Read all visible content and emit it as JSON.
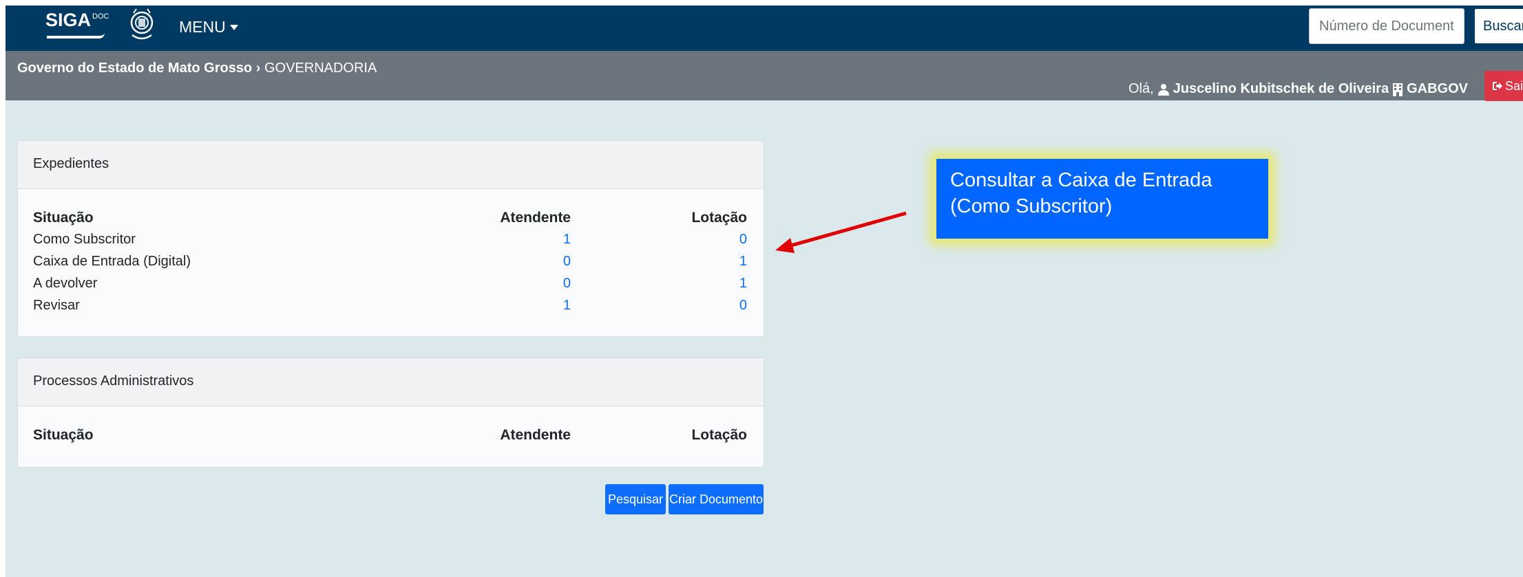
{
  "navbar": {
    "logo_text": "SIGA",
    "logo_sup": "DOC",
    "menu_label": "MENU",
    "doc_search_placeholder": "Número de Documento",
    "search_button": "Buscar"
  },
  "subbar": {
    "breadcrumb_org": "Governo do Estado de Mato Grosso",
    "breadcrumb_sep": "›",
    "breadcrumb_unit": "GOVERNADORIA",
    "greeting": "Olá,",
    "user_name": "Juscelino Kubitschek de Oliveira",
    "unit_code": "GABGOV",
    "logout_label": "Sair"
  },
  "expedientes": {
    "title": "Expedientes",
    "columns": [
      "Situação",
      "Atendente",
      "Lotação"
    ],
    "rows": [
      {
        "situacao": "Como Subscritor",
        "atendente": "1",
        "lotacao": "0"
      },
      {
        "situacao": "Caixa de Entrada (Digital)",
        "atendente": "0",
        "lotacao": "1"
      },
      {
        "situacao": "A devolver",
        "atendente": "0",
        "lotacao": "1"
      },
      {
        "situacao": "Revisar",
        "atendente": "1",
        "lotacao": "0"
      }
    ]
  },
  "processos": {
    "title": "Processos Administrativos",
    "columns": [
      "Situação",
      "Atendente",
      "Lotação"
    ]
  },
  "actions": {
    "search": "Pesquisar",
    "create": "Criar Documento"
  },
  "annotation": {
    "line1": "Consultar a Caixa de Entrada",
    "line2": "(Como Subscritor)",
    "box_color": "#0066ff",
    "arrow_color": "#e00000"
  }
}
